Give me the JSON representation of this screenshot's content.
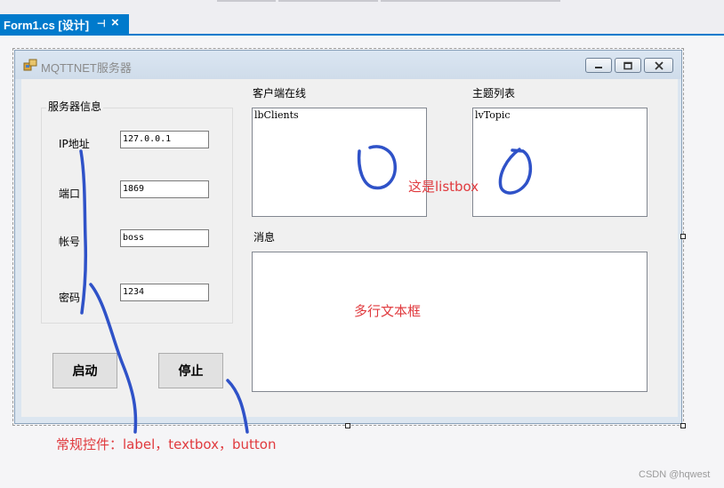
{
  "ide": {
    "tab_title": "Form1.cs [设计]",
    "tab_pin_glyph": "⊣",
    "tab_close_glyph": "×"
  },
  "form": {
    "title": "MQTTNET服务器",
    "caption_icons": [
      "minimize-icon",
      "restore-icon",
      "close-icon"
    ]
  },
  "server_group": {
    "title": "服务器信息",
    "fields": [
      {
        "label": "IP地址",
        "value": "127.0.0.1"
      },
      {
        "label": "端口",
        "value": "1869"
      },
      {
        "label": "帐号",
        "value": "boss"
      },
      {
        "label": "密码",
        "value": "1234"
      }
    ]
  },
  "buttons": {
    "start": "启动",
    "stop": "停止"
  },
  "clients": {
    "label": "客户端在线",
    "listbox_name": "lbClients"
  },
  "topics": {
    "label": "主题列表",
    "listbox_name": "lvTopic"
  },
  "messages": {
    "label": "消息"
  },
  "annotations": {
    "listbox_note": "这是listbox",
    "textbox_note": "多行文本框",
    "controls_note": "常规控件：label，textbox，button",
    "color": "#e03a3e",
    "ink_color": "#2f52c8"
  },
  "watermark": "CSDN @hqwest"
}
